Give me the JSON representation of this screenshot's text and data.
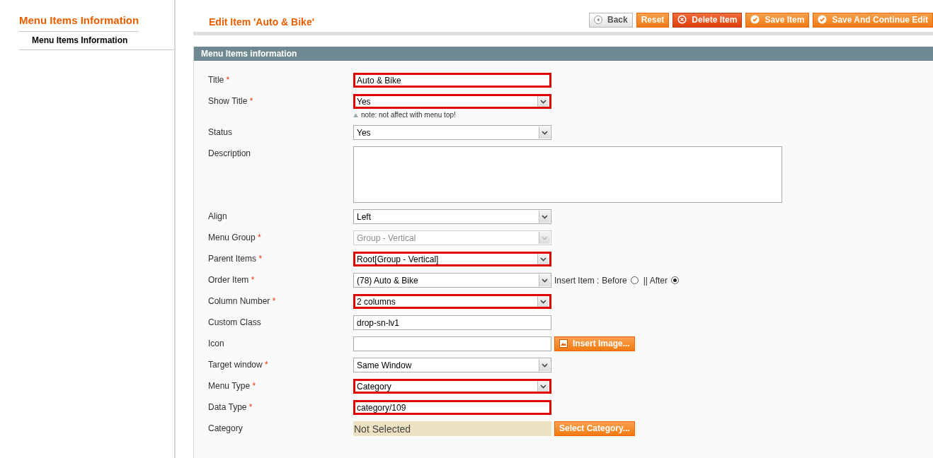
{
  "sidebar": {
    "title": "Menu Items Information",
    "tabs": [
      {
        "label": "Menu Items Information",
        "selected": true
      }
    ]
  },
  "header": {
    "title": "Edit Item 'Auto & Bike'",
    "buttons": [
      {
        "label": "Back",
        "kind": "back"
      },
      {
        "label": "Reset",
        "kind": "plain"
      },
      {
        "label": "Delete Item",
        "kind": "delete"
      },
      {
        "label": "Save Item",
        "kind": "save"
      },
      {
        "label": "Save And Continue Edit",
        "kind": "save"
      }
    ]
  },
  "section": {
    "title": "Menu Items information",
    "fields": [
      {
        "label": "Title",
        "marker": "*",
        "kind": "text",
        "value": "Auto & Bike",
        "highlighted": true
      },
      {
        "label": "Show Title",
        "marker": "*",
        "kind": "select",
        "value": "Yes",
        "highlighted": true,
        "note": "note: not affect with menu top!"
      },
      {
        "label": "Status",
        "kind": "select",
        "value": "Yes",
        "highlighted": false
      },
      {
        "label": "Description",
        "kind": "textarea",
        "highlighted": false
      },
      {
        "label": "Align",
        "kind": "select",
        "value": "Left",
        "highlighted": false
      },
      {
        "label": "Menu Group",
        "marker": "*",
        "kind": "select",
        "value": "Group - Vertical",
        "highlighted": false,
        "disabled": true
      },
      {
        "label": "Parent Items",
        "marker": "*",
        "kind": "select",
        "value": "Root[Group - Vertical]",
        "highlighted": true
      },
      {
        "label": "Order Item",
        "marker": "*",
        "kind": "select",
        "value": "(78) Auto & Bike",
        "highlighted": false,
        "insert_label": "Insert Item : ",
        "radios": [
          {
            "label": "Before",
            "selected": false
          },
          {
            "label": "|| After",
            "selected": true
          }
        ]
      },
      {
        "label": "Column Number",
        "marker": "*",
        "kind": "select",
        "value": "2 columns",
        "highlighted": true
      },
      {
        "label": "Custom Class",
        "kind": "text",
        "value": "drop-sn-lv1",
        "highlighted": false
      },
      {
        "label": "Icon",
        "kind": "text",
        "highlighted": false,
        "button": "Insert Image..."
      },
      {
        "label": "Target window",
        "marker": "*",
        "kind": "select",
        "value": "Same Window",
        "highlighted": false
      },
      {
        "label": "Menu Type",
        "marker": "*",
        "kind": "select",
        "value": "Category",
        "highlighted": true
      },
      {
        "label": "Data Type",
        "marker": "*",
        "kind": "text",
        "value": "category/109",
        "highlighted": true
      },
      {
        "label": "Category",
        "kind": "display",
        "value": "Not Selected",
        "button": "Select Category..."
      }
    ]
  }
}
